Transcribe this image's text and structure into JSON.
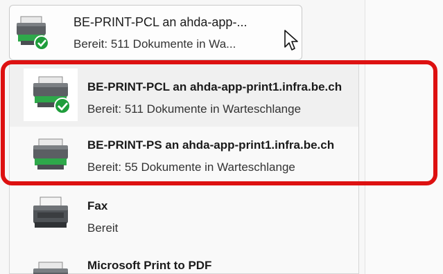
{
  "selected_printer": {
    "name": "BE-PRINT-PCL an ahda-app-...",
    "status": "Bereit: 511 Dokumente in Wa..."
  },
  "printers": [
    {
      "name": "BE-PRINT-PCL an ahda-app-print1.infra.be.ch",
      "status": "Bereit: 511 Dokumente in Warteschlange",
      "icon": "printer-default-icon",
      "selected": true
    },
    {
      "name": "BE-PRINT-PS an ahda-app-print1.infra.be.ch",
      "status": "Bereit: 55 Dokumente in Warteschlange",
      "icon": "printer-icon"
    },
    {
      "name": "Fax",
      "status": "Bereit",
      "icon": "fax-icon"
    },
    {
      "name": "Microsoft Print to PDF",
      "status": "",
      "icon": "printer-icon"
    }
  ],
  "colors": {
    "highlight": "#dd1111",
    "accent_green": "#21a366",
    "default_check": "#1f9d3b"
  }
}
